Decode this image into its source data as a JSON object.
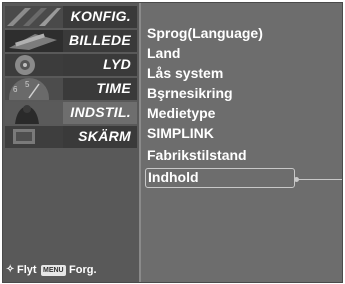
{
  "menu": {
    "items": [
      {
        "label": "KONFIG.",
        "icon": "setup-thumb-icon"
      },
      {
        "label": "BILLEDE",
        "icon": "picture-thumb-icon"
      },
      {
        "label": "LYD",
        "icon": "audio-thumb-icon"
      },
      {
        "label": "TIME",
        "icon": "time-thumb-icon"
      },
      {
        "label": "INDSTIL.",
        "icon": "option-thumb-icon",
        "selected": true
      },
      {
        "label": "SKÄRM",
        "icon": "screen-thumb-icon"
      }
    ]
  },
  "options": [
    "Sprog(Language)",
    "Land",
    "Lås system",
    "Bşrnesikring",
    "Medietype",
    "SIMPLINK",
    "Fabrikstilstand",
    "Indhold"
  ],
  "highlighted_option": "Indhold",
  "footer": {
    "move_label": "Flyt",
    "menu_key": "MENU",
    "prev_label": "Forg."
  },
  "colors": {
    "panel_bg": "#6d6d6d",
    "menu_bg": "#3a3a3a",
    "selected_bg": "#6e6e6e",
    "text": "#ffffff"
  }
}
